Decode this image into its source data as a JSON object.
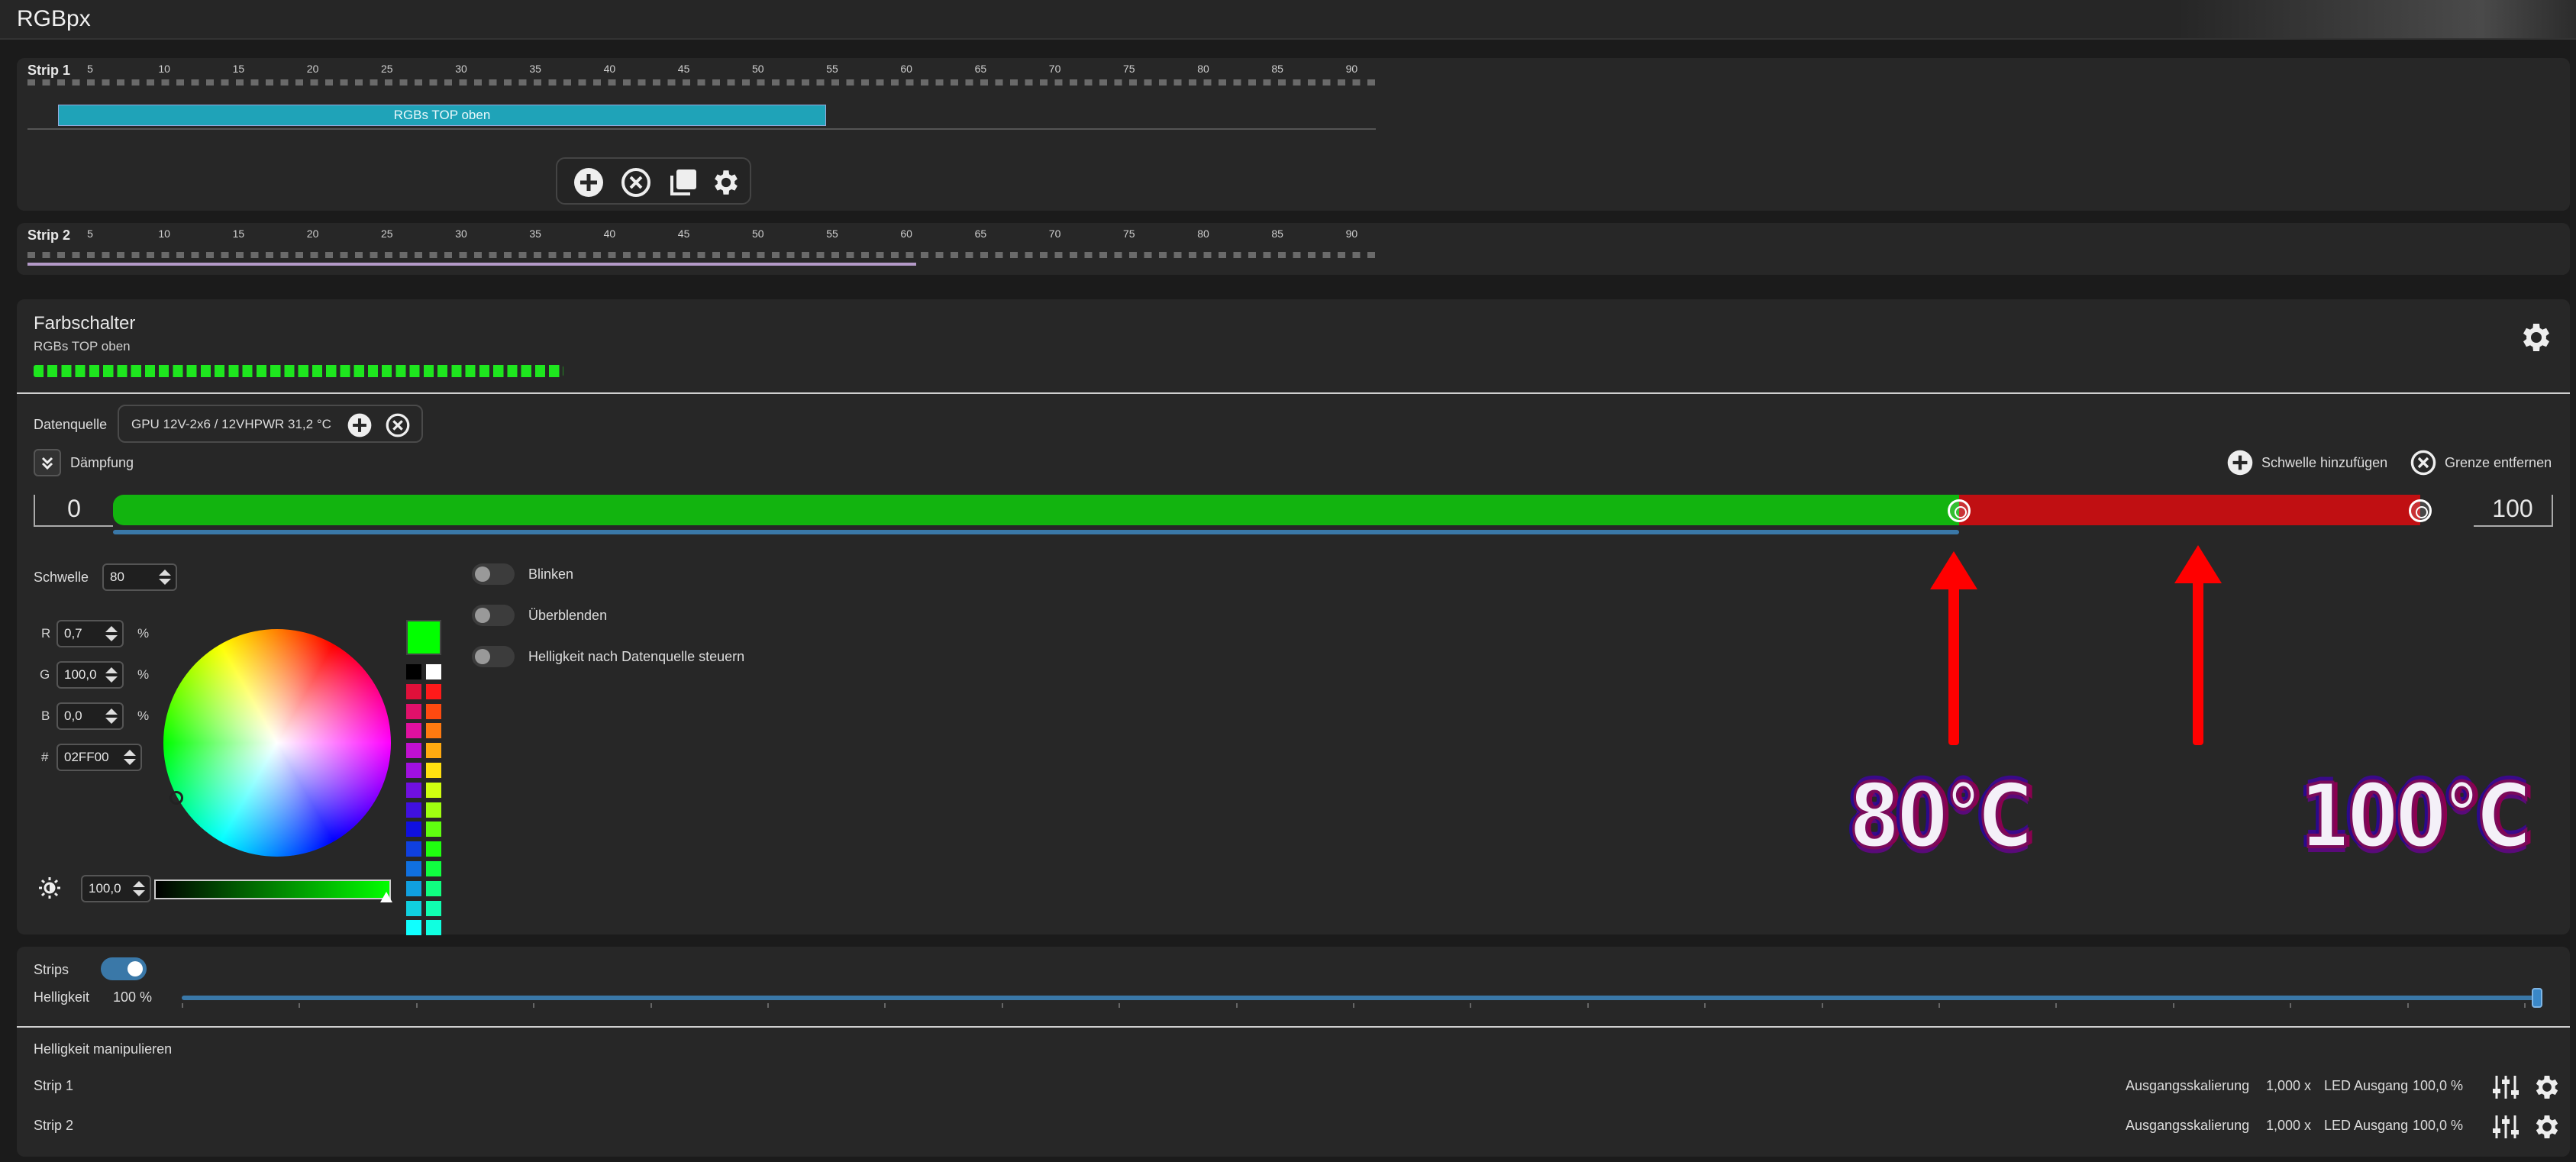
{
  "app": {
    "title": "RGBpx"
  },
  "strip1": {
    "label": "Strip 1",
    "ruler": [
      "5",
      "10",
      "15",
      "20",
      "25",
      "30",
      "35",
      "40",
      "45",
      "50",
      "55",
      "60",
      "65",
      "70",
      "75",
      "80",
      "85",
      "90"
    ],
    "segment_label": "RGBs TOP oben",
    "toolbar": {
      "icons": [
        "plus-circle-icon",
        "x-circle-icon",
        "copy-icon",
        "gear-icon"
      ]
    }
  },
  "strip2": {
    "label": "Strip 2",
    "ruler": [
      "5",
      "10",
      "15",
      "20",
      "25",
      "30",
      "35",
      "40",
      "45",
      "50",
      "55",
      "60",
      "65",
      "70",
      "75",
      "80",
      "85",
      "90"
    ]
  },
  "editor": {
    "title": "Farbschalter",
    "subtitle": "RGBs TOP oben",
    "led_color": "#1ee61e",
    "datasource": {
      "label": "Datenquelle",
      "value": "GPU 12V-2x6 / 12VHPWR   31,2 °C"
    },
    "daempfung_label": "Dämpfung",
    "add_threshold_label": "Schwelle hinzufügen",
    "remove_limit_label": "Grenze entfernen",
    "range": {
      "min": "0",
      "max": "100",
      "threshold": 80,
      "max_threshold": 100,
      "low_color": "#12b40f",
      "high_color": "#c00f12"
    },
    "schwelle": {
      "label": "Schwelle",
      "value": "80"
    },
    "rgb": {
      "r_label": "R",
      "r_value": "0,7",
      "g_label": "G",
      "g_value": "100,0",
      "b_label": "B",
      "b_value": "0,0",
      "unit": "%",
      "hex_label": "#",
      "hex_value": "02FF00"
    },
    "current_color": "#02ff00",
    "palette": [
      [
        "#000000",
        "#ffffff"
      ],
      [
        "#e0103a",
        "#ff1a1a"
      ],
      [
        "#e0106a",
        "#ff4a10"
      ],
      [
        "#e010a0",
        "#ff7a10"
      ],
      [
        "#c010d0",
        "#ffaa10"
      ],
      [
        "#a010e0",
        "#ffe010"
      ],
      [
        "#7010e0",
        "#d0ff10"
      ],
      [
        "#4010e0",
        "#a0ff10"
      ],
      [
        "#1010e0",
        "#60ff10"
      ],
      [
        "#1040e0",
        "#20ff10"
      ],
      [
        "#1070e0",
        "#10ff40"
      ],
      [
        "#10a0e0",
        "#10ff80"
      ],
      [
        "#10d0e0",
        "#10ffb0"
      ],
      [
        "#10ffff",
        "#10ffe0"
      ]
    ],
    "brightness_value": "100,0",
    "toggles": [
      {
        "label": "Blinken",
        "on": false
      },
      {
        "label": "Überblenden",
        "on": false
      },
      {
        "label": "Helligkeit nach Datenquelle steuern",
        "on": false
      }
    ],
    "annotations": {
      "left": "80°C",
      "right": "100°C"
    }
  },
  "bottom": {
    "strips_label": "Strips",
    "strips_on": true,
    "helligkeit_label": "Helligkeit",
    "helligkeit_value": "100 %",
    "helligkeit_level": 1.0,
    "manip_label": "Helligkeit manipulieren",
    "rows": [
      {
        "name": "Strip 1",
        "scale_label": "Ausgangsskalierung",
        "scale_value": "1,000 x",
        "led_label": "LED Ausgang",
        "led_value": "100,0 %"
      },
      {
        "name": "Strip 2",
        "scale_label": "Ausgangsskalierung",
        "scale_value": "1,000 x",
        "led_label": "LED Ausgang",
        "led_value": "100,0 %"
      }
    ]
  }
}
